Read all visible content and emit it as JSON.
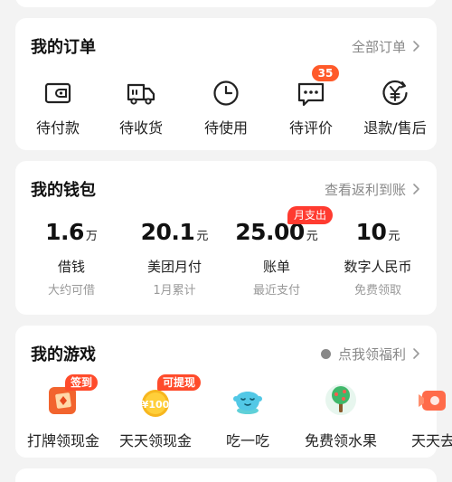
{
  "orders": {
    "title": "我的订单",
    "all_link": "全部订单",
    "items": [
      {
        "label": "待付款",
        "icon": "wallet-icon"
      },
      {
        "label": "待收货",
        "icon": "delivery-truck-icon"
      },
      {
        "label": "待使用",
        "icon": "clock-icon"
      },
      {
        "label": "待评价",
        "icon": "comment-icon",
        "badge": "35"
      },
      {
        "label": "退款/售后",
        "icon": "refund-yen-icon"
      }
    ]
  },
  "wallet": {
    "title": "我的钱包",
    "link": "查看返利到账",
    "items": [
      {
        "amount": "1.6",
        "unit": "万",
        "label": "借钱",
        "sub": "大约可借"
      },
      {
        "amount": "20.1",
        "unit": "元",
        "label": "美团月付",
        "sub": "1月累计"
      },
      {
        "amount": "25.00",
        "unit": "元",
        "label": "账单",
        "sub": "最近支付",
        "badge": "月支出"
      },
      {
        "amount": "10",
        "unit": "元",
        "label": "数字人民币",
        "sub": "免费领取"
      }
    ]
  },
  "games": {
    "title": "我的游戏",
    "link": "点我领福利",
    "items": [
      {
        "label": "打牌领现金",
        "tag": "签到",
        "icon": "card-game-icon"
      },
      {
        "label": "天天领现金",
        "tag": "可提现",
        "icon": "coin-100-icon",
        "coin_text": "¥100"
      },
      {
        "label": "吃一吃",
        "icon": "eat-mascot-icon"
      },
      {
        "label": "免费领水果",
        "icon": "fruit-tree-icon"
      },
      {
        "label": "天天去",
        "icon": "game-partial-icon"
      }
    ]
  },
  "colors": {
    "accent": "#ff5a2a",
    "badge_red": "#ff3b30",
    "text_muted": "#888888"
  }
}
